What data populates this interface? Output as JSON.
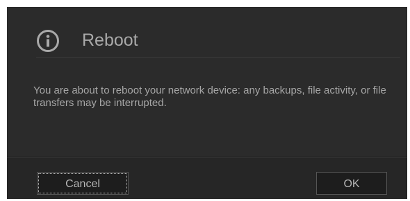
{
  "dialog": {
    "icon": "info-icon",
    "title": "Reboot",
    "message": "You are about to reboot your network device: any backups, file activity, or file transfers may be interrupted.",
    "buttons": {
      "cancel_label": "Cancel",
      "ok_label": "OK"
    }
  },
  "colors": {
    "background": "#2b2b2b",
    "text": "#a6a6a6",
    "button_background": "#1d1d1d",
    "button_border": "#555555"
  }
}
